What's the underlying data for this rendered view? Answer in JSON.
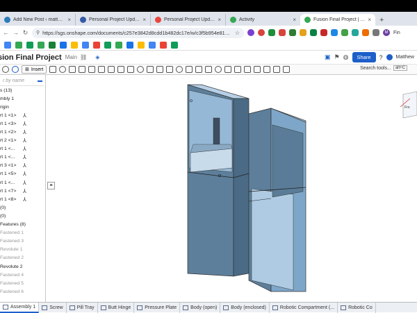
{
  "browser": {
    "tabs": [
      {
        "title": "Add New Post ‹ matthewa –",
        "fav": "#2b7bb9",
        "active": false
      },
      {
        "title": "Personal Project Update ‹ jo",
        "fav": "#3559a8",
        "active": false
      },
      {
        "title": "Personal Project Update",
        "fav": "#e8453c",
        "active": false
      },
      {
        "title": "Activity",
        "fav": "#34a853",
        "active": false
      },
      {
        "title": "Fusion Final Project | Assemb",
        "fav": "#34a853",
        "active": true
      }
    ],
    "new_tab": "+",
    "url": "https://sgs.onshape.com/documents/c257e3842d8cdd1b482dc17e/w/c3f5b954e81a8a67...",
    "profile_initial": "M",
    "profile_label": "Fin"
  },
  "onshape": {
    "doc_title": "sion Final Project",
    "workspace": "Main",
    "share_label": "Share",
    "user": "Matthew",
    "insert_label": "Insert",
    "search_tools": "Search tools...",
    "units": "alt+C"
  },
  "tree": {
    "filter_placeholder": "r by name",
    "items": [
      {
        "label": "s (13)",
        "grey": false,
        "mate": ""
      },
      {
        "label": "mbly 1",
        "grey": false,
        "mate": ""
      },
      {
        "label": "rigin",
        "grey": false,
        "mate": ""
      },
      {
        "label": "rt 1 <1>",
        "grey": false,
        "mate": "⅄"
      },
      {
        "label": "rt 1 <3>",
        "grey": false,
        "mate": "⅄"
      },
      {
        "label": "rt 1 <2>",
        "grey": false,
        "mate": "⅄"
      },
      {
        "label": "rt 2 <1>",
        "grey": false,
        "mate": "⅄"
      },
      {
        "label": "rt 1 <...",
        "grey": false,
        "mate": "⅄"
      },
      {
        "label": "rt 1 <...",
        "grey": false,
        "mate": "⅄"
      },
      {
        "label": "rt 3 <1>",
        "grey": false,
        "mate": "⅄"
      },
      {
        "label": "rt 1 <5>",
        "grey": false,
        "mate": "⅄"
      },
      {
        "label": "rt 1 <...",
        "grey": false,
        "mate": "⅄"
      },
      {
        "label": "rt 1 <7>",
        "grey": false,
        "mate": "⅄"
      },
      {
        "label": "rt 1 <8>",
        "grey": false,
        "mate": "⅄"
      },
      {
        "label": "(0)",
        "grey": false,
        "mate": ""
      },
      {
        "label": "(0)",
        "grey": false,
        "mate": ""
      },
      {
        "label": "Features (8)",
        "grey": false,
        "mate": ""
      },
      {
        "label": "Fastened 1",
        "grey": true,
        "mate": ""
      },
      {
        "label": "Fastened 3",
        "grey": true,
        "mate": ""
      },
      {
        "label": "Revolute 1",
        "grey": true,
        "mate": ""
      },
      {
        "label": "Fastened 2",
        "grey": true,
        "mate": ""
      },
      {
        "label": "Revolute 2",
        "grey": false,
        "mate": ""
      },
      {
        "label": "Fastened 4",
        "grey": true,
        "mate": ""
      },
      {
        "label": "Fastened 5",
        "grey": true,
        "mate": ""
      },
      {
        "label": "Fastened 6",
        "grey": true,
        "mate": ""
      }
    ]
  },
  "bottom_tabs": [
    {
      "label": "Assembly 1",
      "active": true
    },
    {
      "label": "Screw",
      "active": false
    },
    {
      "label": "Pill Tray",
      "active": false
    },
    {
      "label": "Butt Hinge",
      "active": false
    },
    {
      "label": "Pressure Plate",
      "active": false
    },
    {
      "label": "Body (open)",
      "active": false
    },
    {
      "label": "Body (enclosed)",
      "active": false
    },
    {
      "label": "Robotic Compartment (...",
      "active": false
    },
    {
      "label": "Robotic Co",
      "active": false
    }
  ],
  "colors": {
    "model_face": "#8db2d3",
    "model_dark": "#54758f",
    "model_inner": "#a9c6df",
    "accent": "#1d5fc9"
  },
  "viewcube": {
    "label": "Fro"
  }
}
